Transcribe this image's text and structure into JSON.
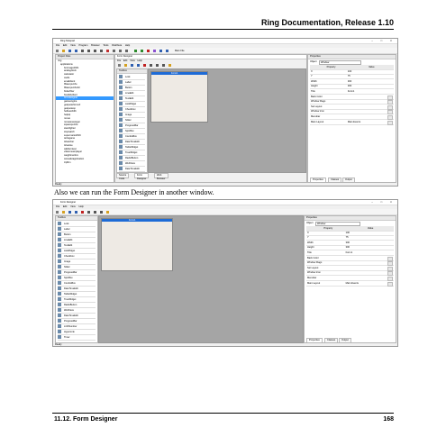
{
  "page": {
    "header": "Ring Documentation, Release 1.10",
    "caption": "Also we can run the Form Designer in another window.",
    "footer_left": "11.12.  Form Designer",
    "footer_right": "168"
  },
  "shot1": {
    "title": "Ring Notepad",
    "menu": [
      "File",
      "Edit",
      "View",
      "Program",
      "Browser",
      "Tools",
      "Distribute",
      "Help"
    ],
    "mode_label": "Main File",
    "project_panel": "Project Files",
    "tree": [
      "ring",
      "applications",
      "bmimage2021",
      "analogclock",
      "calculator",
      "cards",
      "emailclient",
      "fifteenpuzzle",
      "fifteenpuzzle3d",
      "flutterfliter",
      "fivedidxclient",
      "formdesigner",
      "gameengine",
      "getquotefromurl",
      "getquotesp",
      "helloworldfn",
      "helpqt",
      "movie",
      "moviesnewsgui",
      "squarepuzzle",
      "starsfighter",
      "stopwatch",
      "supermario2016",
      "tetrisgame",
      "ticketcher",
      "tictactoe",
      "wikiformtest",
      "videomusicplayer",
      "weightmetrics",
      "wmsaferapplication",
      "zipfilm"
    ],
    "designer_title": "Form Designer",
    "designer_menu": [
      "File",
      "Edit",
      "View",
      "Help"
    ],
    "toolbox_label": "Toolbox",
    "tools": [
      "Lock",
      "Label",
      "Button",
      "LineEdit",
      "TextEdit",
      "ListWidget",
      "Checkbox",
      "Image",
      "Slider",
      "ProgressBar",
      "SpinBox",
      "ComboBox",
      "DateTimeEdit",
      "TableWidget",
      "TreeWidget",
      "RadioButton",
      "WebView",
      "DateTimeEdit",
      "ProgressBar"
    ],
    "form_title": "Form1",
    "properties_panel": "Properties",
    "object_label": "Object",
    "object_value": "Window",
    "prop_header": [
      "Property",
      "Value"
    ],
    "props": [
      {
        "k": "X",
        "v": "100"
      },
      {
        "k": "Y",
        "v": "75"
      },
      {
        "k": "Width",
        "v": "300"
      },
      {
        "k": "Height",
        "v": "300"
      },
      {
        "k": "Title",
        "v": "Form1"
      },
      {
        "k": "Back Color",
        "v": ""
      },
      {
        "k": "Window Flags",
        "v": ""
      },
      {
        "k": "Set Layout",
        "v": ""
      },
      {
        "k": "Window Icon",
        "v": ""
      },
      {
        "k": "Menubar",
        "v": ""
      },
      {
        "k": "Main Layout",
        "v": "Main Events"
      }
    ],
    "bottom_tabs": [
      "Source Code",
      "Form Designer",
      "Web Browser"
    ],
    "right_tabs": [
      "Properties",
      "Classes",
      "Output"
    ],
    "status": "Ready"
  },
  "shot2": {
    "title": "Form Designer",
    "menu": [
      "File",
      "Edit",
      "View",
      "Help"
    ],
    "toolbox_label": "Toolbox",
    "tools": [
      "Lock",
      "Label",
      "Button",
      "LineEdit",
      "TextEdit",
      "ListWidget",
      "Checkbox",
      "Image",
      "Slider",
      "ProgressBar",
      "SpinBox",
      "ComboBox",
      "DateTimeEdit",
      "TableWidget",
      "TreeWidget",
      "RadioButton",
      "WebView",
      "DateTimeEdit",
      "ProgressBar",
      "LCDNumber",
      "HyperLink",
      "Timer"
    ],
    "form_title": "Form1",
    "properties_panel": "Properties",
    "object_label": "Object",
    "object_value": "Window",
    "prop_header": [
      "Property",
      "Value"
    ],
    "props": [
      {
        "k": "X",
        "v": "100"
      },
      {
        "k": "Y",
        "v": "75"
      },
      {
        "k": "Width",
        "v": "300"
      },
      {
        "k": "Height",
        "v": "300"
      },
      {
        "k": "Title",
        "v": "Form1"
      },
      {
        "k": "Back Color",
        "v": ""
      },
      {
        "k": "Window Flags",
        "v": ""
      },
      {
        "k": "Set Layout",
        "v": ""
      },
      {
        "k": "Window Icon",
        "v": ""
      },
      {
        "k": "Menubar",
        "v": ""
      },
      {
        "k": "Main Layout",
        "v": "Main Events"
      }
    ],
    "right_tabs": [
      "Properties",
      "Classes",
      "Output"
    ],
    "status": "Ready"
  },
  "colors": {
    "selection": "#3399ff",
    "form_bar": "#1e6bd6",
    "canvas": "#a5a5a5",
    "form_bg": "#eeeae4"
  }
}
